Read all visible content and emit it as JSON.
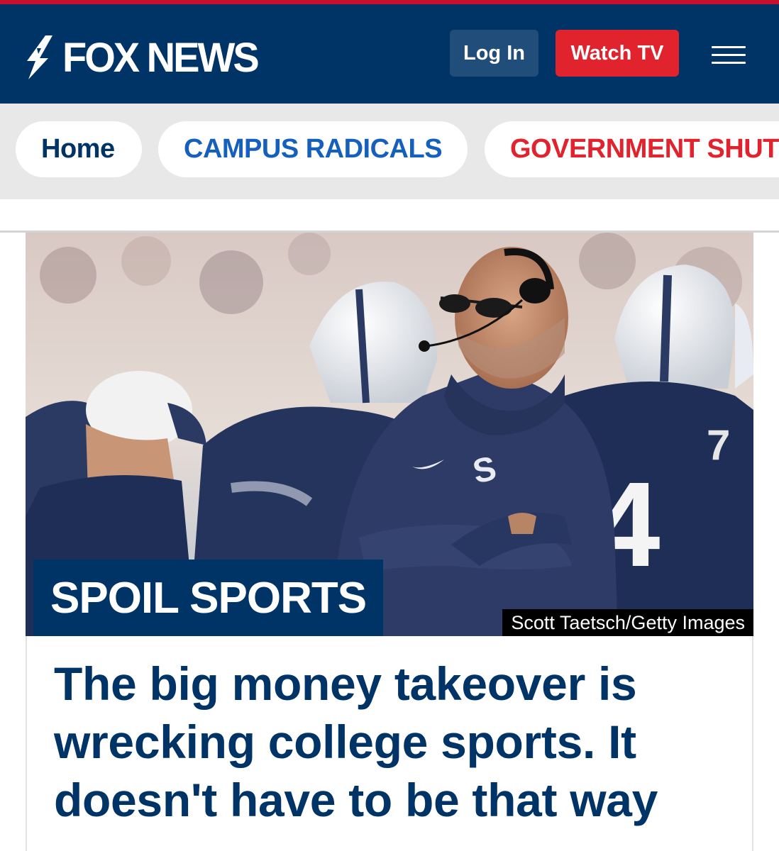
{
  "header": {
    "logo_text": "FOX NEWS",
    "login_label": "Log In",
    "watch_label": "Watch TV"
  },
  "nav": {
    "items": [
      {
        "label": "Home",
        "color": "#003366"
      },
      {
        "label": "CAMPUS RADICALS",
        "color": "#1560bd"
      },
      {
        "label": "GOVERNMENT SHUT",
        "color": "#e0232d"
      }
    ]
  },
  "hero": {
    "kicker": "SPOIL SPORTS",
    "credit": "Scott Taetsch/Getty Images"
  },
  "article": {
    "headline": "The big money takeover is wrecking college sports. It doesn't have to be that way"
  },
  "colors": {
    "brand_navy": "#003366",
    "accent_red": "#e0232d",
    "link_blue": "#1560bd"
  }
}
